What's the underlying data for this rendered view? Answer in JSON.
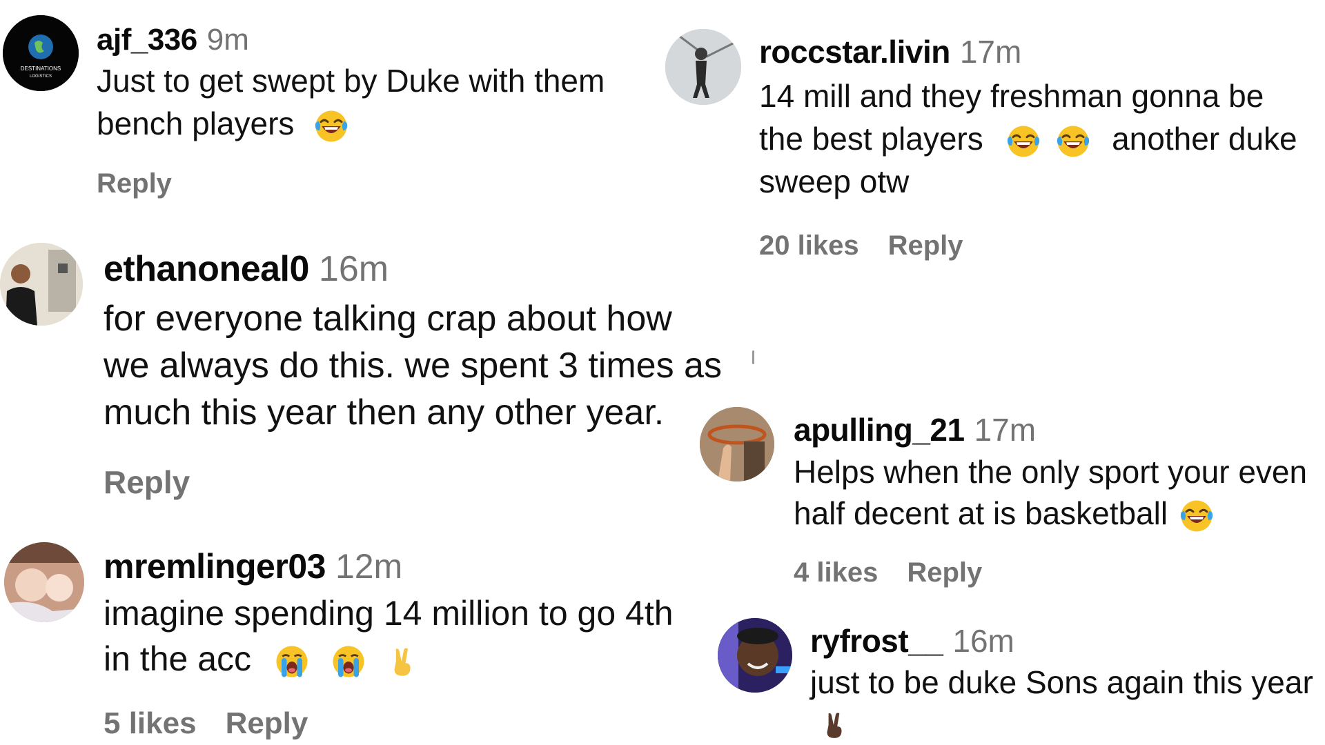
{
  "comments": [
    {
      "username": "ajf_336",
      "time": "9m",
      "lines": [
        "Just to get swept by Duke with them",
        "bench players"
      ],
      "emojis_line2": [
        "laughing-emoji"
      ],
      "reply": "Reply",
      "avatar_text": [
        "DESTINATIONS",
        "LOGISTICS"
      ]
    },
    {
      "username": "ethanoneal0",
      "time": "16m",
      "lines": [
        "for everyone talking crap about how",
        "we always do this. we spent 3 times as",
        "much this year then any other year."
      ],
      "reply": "Reply"
    },
    {
      "username": "mremlinger03",
      "time": "12m",
      "lines": [
        "imagine spending 14 million to go 4th",
        "in the acc"
      ],
      "emojis_line2": [
        "loudly-crying-emoji",
        "loudly-crying-emoji",
        "victory-hand-emoji"
      ],
      "likes": "5 likes",
      "reply": "Reply"
    },
    {
      "username": "roccstar.livin",
      "time": "17m",
      "lines": [
        "14 mill and they freshman gonna be",
        "the best players",
        "another duke",
        "sweep otw"
      ],
      "emojis_line2": [
        "laughing-emoji",
        "laughing-emoji"
      ],
      "likes": "20 likes",
      "reply": "Reply"
    },
    {
      "username": "apulling_21",
      "time": "17m",
      "lines": [
        "Helps when the only sport your even",
        "half decent at is basketball"
      ],
      "emojis_line2": [
        "laughing-emoji"
      ],
      "likes": "4 likes",
      "reply": "Reply"
    },
    {
      "username": "ryfrost__",
      "time": "16m",
      "lines": [
        "just to be duke Sons again this year"
      ],
      "emojis_line2": [
        "victory-hand-dark-emoji"
      ]
    }
  ],
  "colors": {
    "text": "#111111",
    "muted": "#737373",
    "laugh_face": "#f7c325",
    "laugh_tears": "#3aa3e8",
    "victory_light": "#f6c443",
    "victory_dark": "#5a3a2c"
  }
}
